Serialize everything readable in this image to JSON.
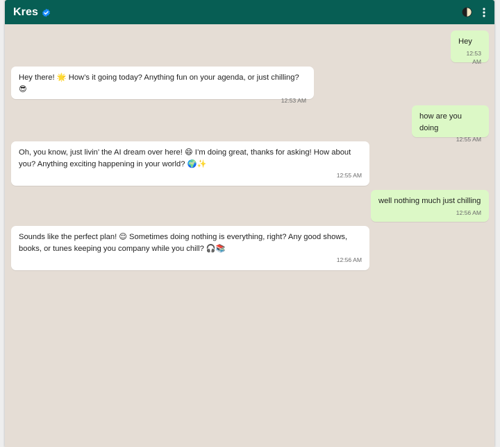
{
  "header": {
    "contact_name": "Kres",
    "verified_icon": "verified-badge-icon",
    "theme_icon": "half-moon-theme-icon",
    "menu_icon": "more-vertical-icon",
    "colors": {
      "header_bg": "#075e54",
      "chat_bg": "#e5ddd5",
      "outgoing_bubble": "#dcf8c6",
      "incoming_bubble": "#ffffff",
      "verified": "#1a8cff"
    }
  },
  "messages": [
    {
      "direction": "out",
      "text": "Hey",
      "time": "12:53 AM"
    },
    {
      "direction": "in",
      "text": "Hey there! 🌟 How’s it going today? Anything fun on your agenda, or just chilling? 😎",
      "time": "12:53 AM"
    },
    {
      "direction": "out",
      "text": "how are you doing",
      "time": "12:55 AM"
    },
    {
      "direction": "in",
      "text": "Oh, you know, just livin’ the AI dream over here! 😄 I’m doing great, thanks for asking! How about you? Anything exciting happening in your world? 🌍✨",
      "time": "12:55 AM"
    },
    {
      "direction": "out",
      "text": "well nothing much just chilling",
      "time": "12:56 AM"
    },
    {
      "direction": "in",
      "text": "Sounds like the perfect plan! 😌 Sometimes doing nothing is everything, right? Any good shows, books, or tunes keeping you company while you chill? 🎧📚",
      "time": "12:56 AM"
    }
  ]
}
